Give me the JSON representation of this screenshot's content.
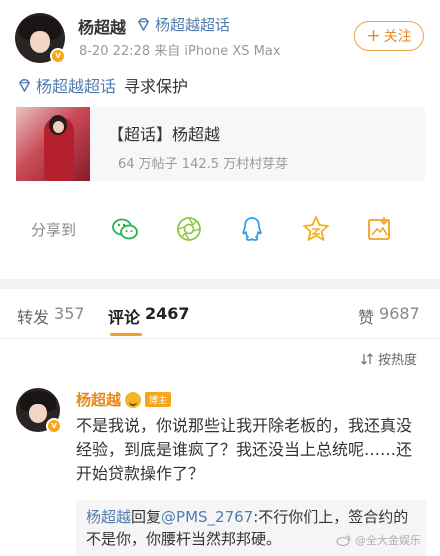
{
  "post": {
    "username": "杨超越",
    "supertopic": "杨超越超话",
    "meta": "8-20 22:28  来自 iPhone XS Max",
    "follow_label": "关注",
    "follow_plus": "+",
    "content_topic": "杨超越超话",
    "content_text": "寻求保护",
    "v_badge": "v"
  },
  "topic_card": {
    "title": "【超话】杨超越",
    "stats": "64 万帖子 142.5 万村村芽芽"
  },
  "share": {
    "label": "分享到",
    "icons": [
      "wechat-icon",
      "moments-icon",
      "qq-icon",
      "qzone-icon",
      "save-image-icon"
    ]
  },
  "tabs": {
    "repost_label": "转发",
    "repost_count": "357",
    "comment_label": "评论",
    "comment_count": "2467",
    "like_label": "赞",
    "like_count": "9687"
  },
  "sort": {
    "label": "按热度"
  },
  "comment": {
    "name": "杨超越",
    "host_badge": "博主",
    "text": "不是我说，你说那些让我开除老板的，我还真没经验，到底是谁疯了？我还没当上总统呢……还开始贷款操作了？",
    "reply_name": "杨超越",
    "reply_verb": "回复",
    "reply_mention": "@PMS_2767",
    "reply_text": ":不行你们上，签合约的不是你，你腰杆当然邦邦硬。"
  },
  "watermark": "@全大金娱乐",
  "colors": {
    "link": "#507daf",
    "accent": "#f49c26",
    "follow": "#e8892a"
  }
}
